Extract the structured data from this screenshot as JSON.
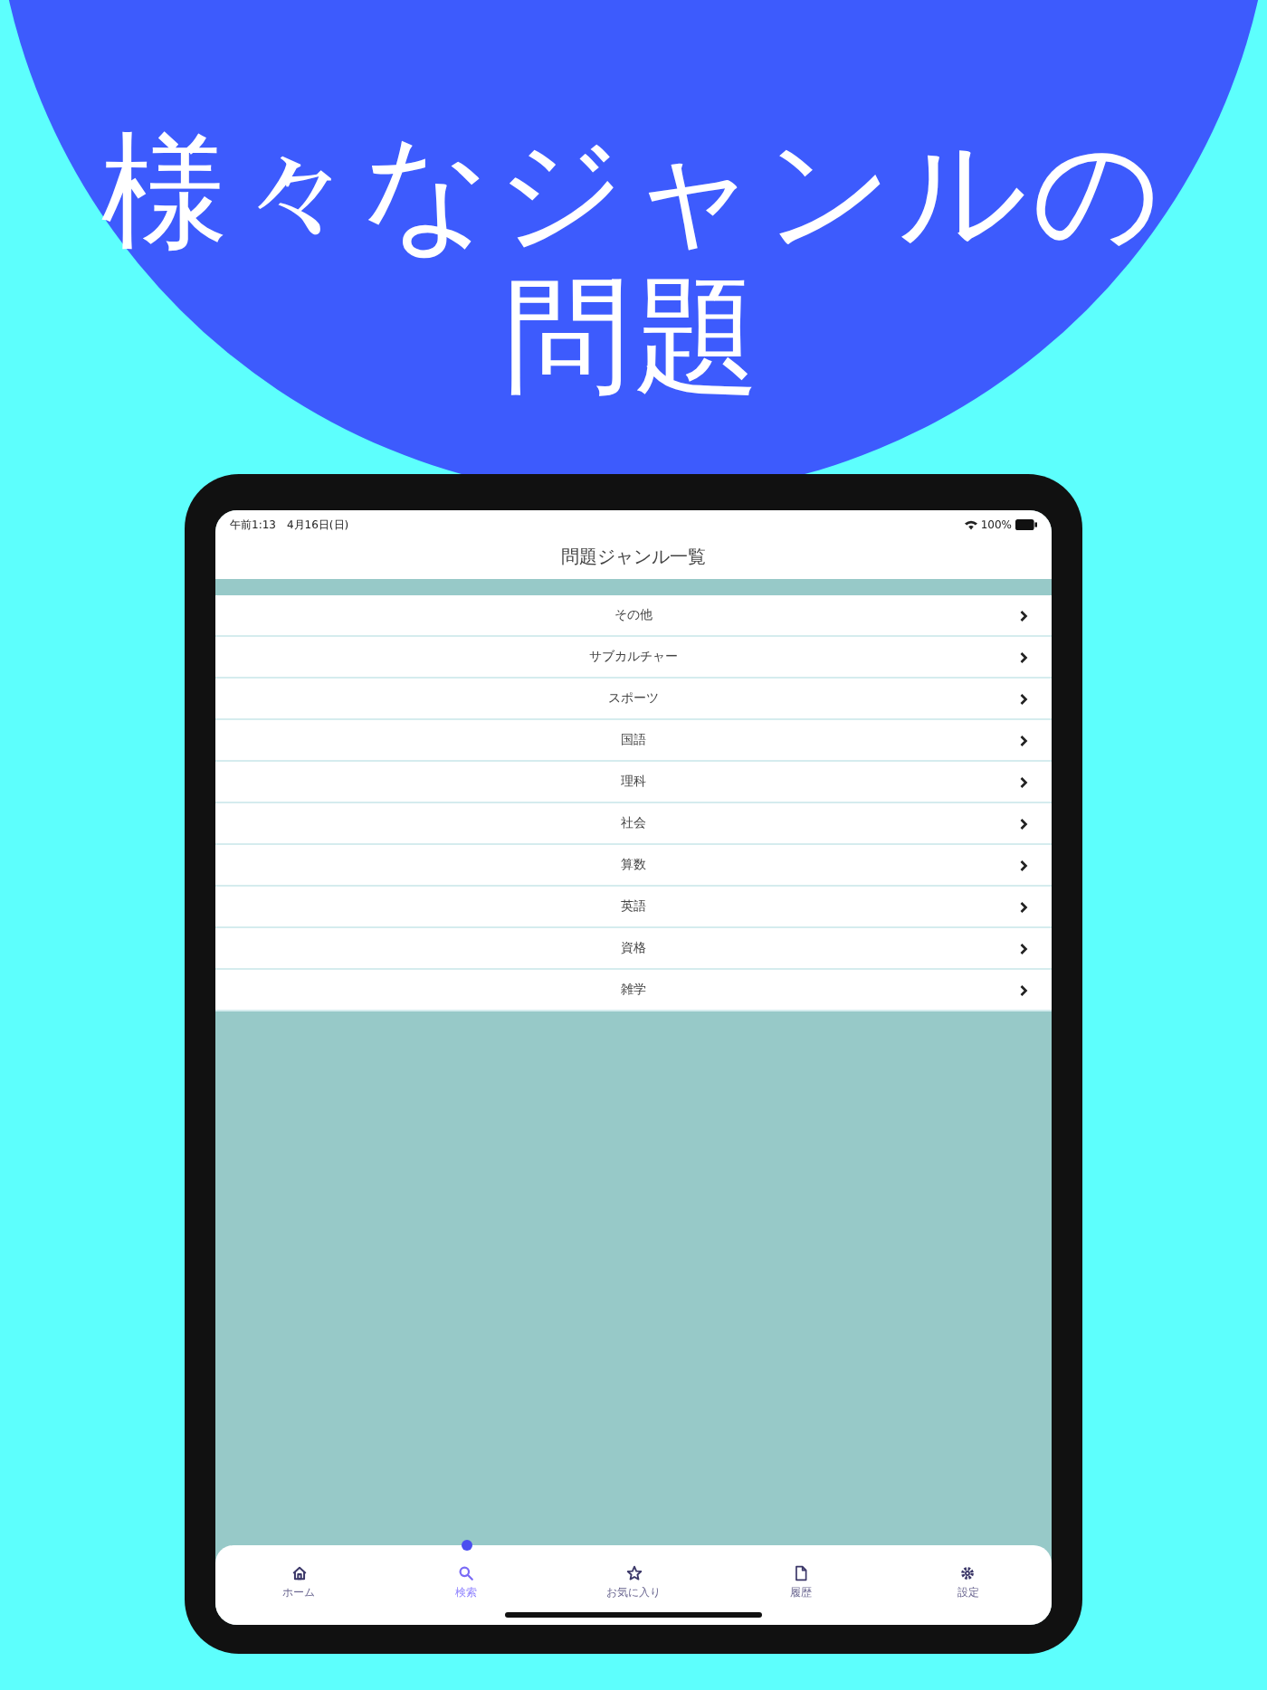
{
  "headline": [
    "様々なジャンルの",
    "問題"
  ],
  "status_bar": {
    "time": "午前1:13　4月16日(日)",
    "battery": "100%"
  },
  "title": "問題ジャンル一覧",
  "genres": [
    {
      "label": "その他"
    },
    {
      "label": "サブカルチャー"
    },
    {
      "label": "スポーツ"
    },
    {
      "label": "国語"
    },
    {
      "label": "理科"
    },
    {
      "label": "社会"
    },
    {
      "label": "算数"
    },
    {
      "label": "英語"
    },
    {
      "label": "資格"
    },
    {
      "label": "雑学"
    }
  ],
  "tabs": [
    {
      "label": "ホーム",
      "kind": "home",
      "selected": false
    },
    {
      "label": "検索",
      "kind": "search",
      "selected": true
    },
    {
      "label": "お気に入り",
      "kind": "favorite",
      "selected": false
    },
    {
      "label": "履歴",
      "kind": "history",
      "selected": false
    },
    {
      "label": "設定",
      "kind": "settings",
      "selected": false
    }
  ]
}
